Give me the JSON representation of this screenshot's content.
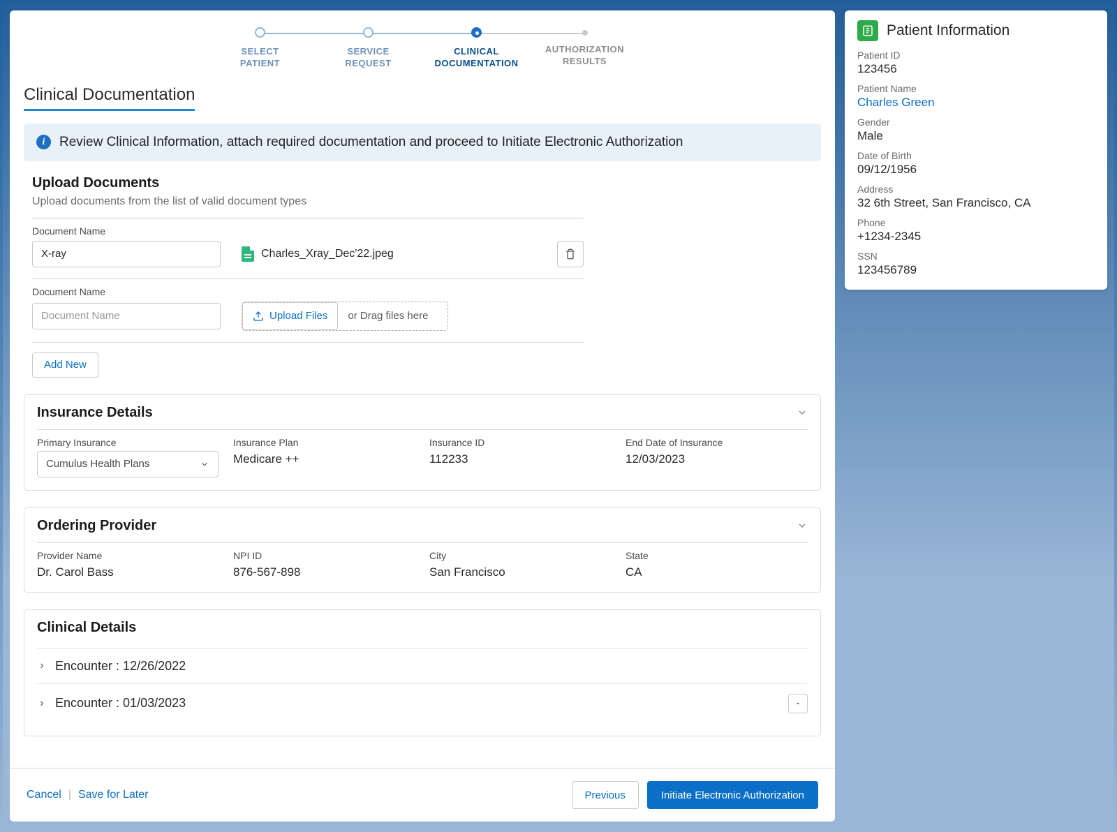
{
  "stepper": {
    "steps": [
      {
        "line1": "SELECT",
        "line2": "PATIENT"
      },
      {
        "line1": "SERVICE",
        "line2": "REQUEST"
      },
      {
        "line1": "CLINICAL",
        "line2": "DOCUMENTATION"
      },
      {
        "line1": "AUTHORIZATION",
        "line2": "RESULTS"
      }
    ]
  },
  "page": {
    "title": "Clinical Documentation",
    "review_text": "Review Clinical Information, attach required documentation and proceed to Initiate Electronic Authorization"
  },
  "upload": {
    "heading": "Upload Documents",
    "sub": "Upload documents from the list of valid document types",
    "doc_name_label": "Document Name",
    "row1_value": "X-ray",
    "row1_file": "Charles_Xray_Dec'22.jpeg",
    "row2_placeholder": "Document Name",
    "upload_files_label": "Upload Files",
    "drag_hint": "or Drag files here",
    "add_new_label": "Add New"
  },
  "insurance": {
    "title": "Insurance Details",
    "primary_label": "Primary Insurance",
    "primary_value": "Cumulus Health Plans",
    "plan_label": "Insurance Plan",
    "plan_value": "Medicare ++",
    "id_label": "Insurance ID",
    "id_value": "112233",
    "end_label": "End Date of Insurance",
    "end_value": "12/03/2023"
  },
  "provider": {
    "title": "Ordering Provider",
    "name_label": "Provider Name",
    "name_value": "Dr. Carol Bass",
    "npi_label": "NPI ID",
    "npi_value": "876-567-898",
    "city_label": "City",
    "city_value": "San Francisco",
    "state_label": "State",
    "state_value": "CA"
  },
  "clinical": {
    "title": "Clinical Details",
    "enc1": "Encounter : 12/26/2022",
    "enc2": "Encounter : 01/03/2023"
  },
  "footer": {
    "cancel": "Cancel",
    "save": "Save for Later",
    "previous": "Previous",
    "initiate": "Initiate Electronic Authorization"
  },
  "patient": {
    "title": "Patient Information",
    "id_label": "Patient ID",
    "id_value": "123456",
    "name_label": "Patient Name",
    "name_value": "Charles Green",
    "gender_label": "Gender",
    "gender_value": "Male",
    "dob_label": "Date of Birth",
    "dob_value": "09/12/1956",
    "address_label": "Address",
    "address_value": "32 6th Street, San Francisco, CA",
    "phone_label": "Phone",
    "phone_value": "+1234-2345",
    "ssn_label": "SSN",
    "ssn_value": "123456789"
  }
}
